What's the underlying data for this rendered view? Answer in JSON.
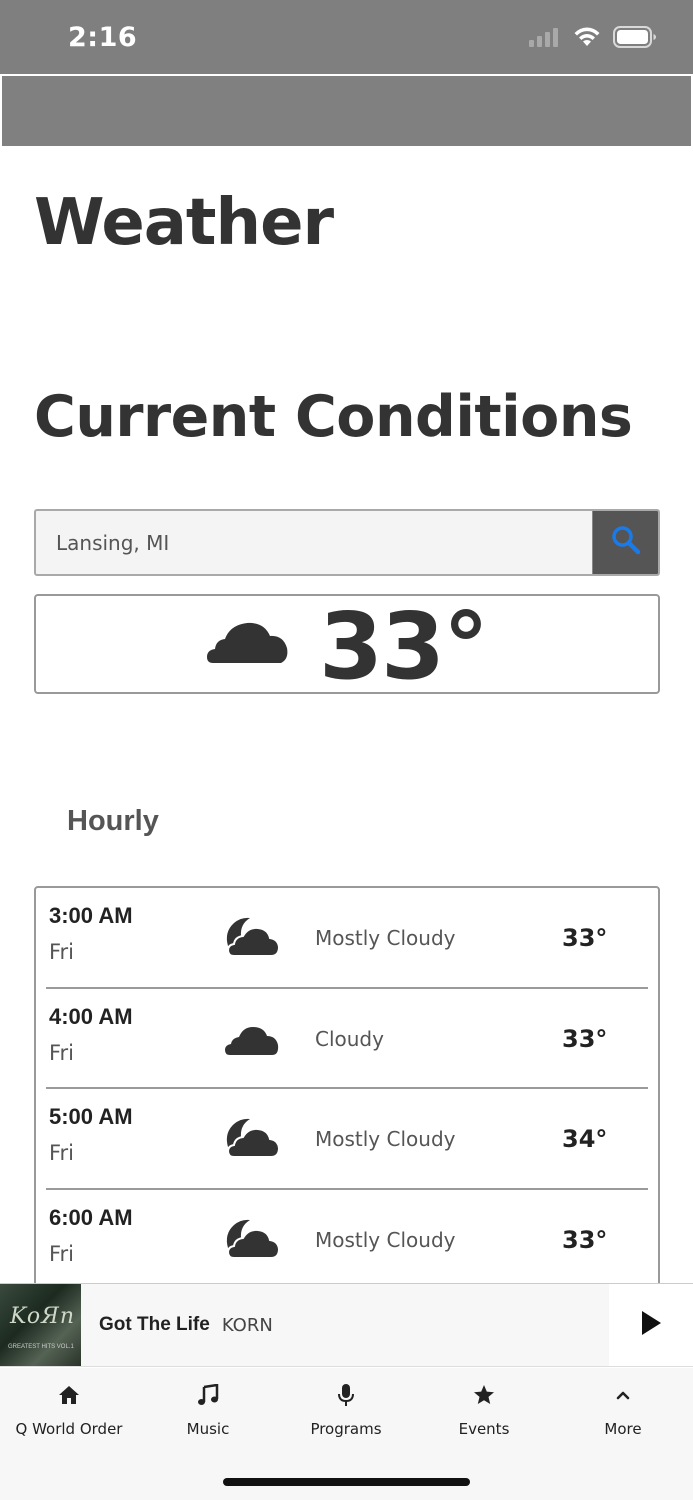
{
  "status": {
    "time": "2:16"
  },
  "page": {
    "title": "Weather"
  },
  "current": {
    "section_title": "Current Conditions",
    "search_value": "Lansing, MI",
    "temp": "33°",
    "icon": "cloud-icon"
  },
  "hourly": {
    "title": "Hourly",
    "rows": [
      {
        "time": "3:00 AM",
        "day": "Fri",
        "icon": "partly-cloudy-night-icon",
        "desc": "Mostly Cloudy",
        "temp": "33°"
      },
      {
        "time": "4:00 AM",
        "day": "Fri",
        "icon": "cloud-icon",
        "desc": "Cloudy",
        "temp": "33°"
      },
      {
        "time": "5:00 AM",
        "day": "Fri",
        "icon": "partly-cloudy-night-icon",
        "desc": "Mostly Cloudy",
        "temp": "34°"
      },
      {
        "time": "6:00 AM",
        "day": "Fri",
        "icon": "partly-cloudy-night-icon",
        "desc": "Mostly Cloudy",
        "temp": "33°"
      }
    ]
  },
  "player": {
    "title": "Got The Life",
    "artist": "KORN"
  },
  "tabs": [
    {
      "label": "Q World Order",
      "icon": "home-icon"
    },
    {
      "label": "Music",
      "icon": "music-note-icon"
    },
    {
      "label": "Programs",
      "icon": "microphone-icon"
    },
    {
      "label": "Events",
      "icon": "star-icon"
    },
    {
      "label": "More",
      "icon": "chevron-up-icon"
    }
  ],
  "colors": {
    "status_bar": "#7f7f7f",
    "search_icon": "#1a7be8",
    "text_dark": "#333333"
  }
}
